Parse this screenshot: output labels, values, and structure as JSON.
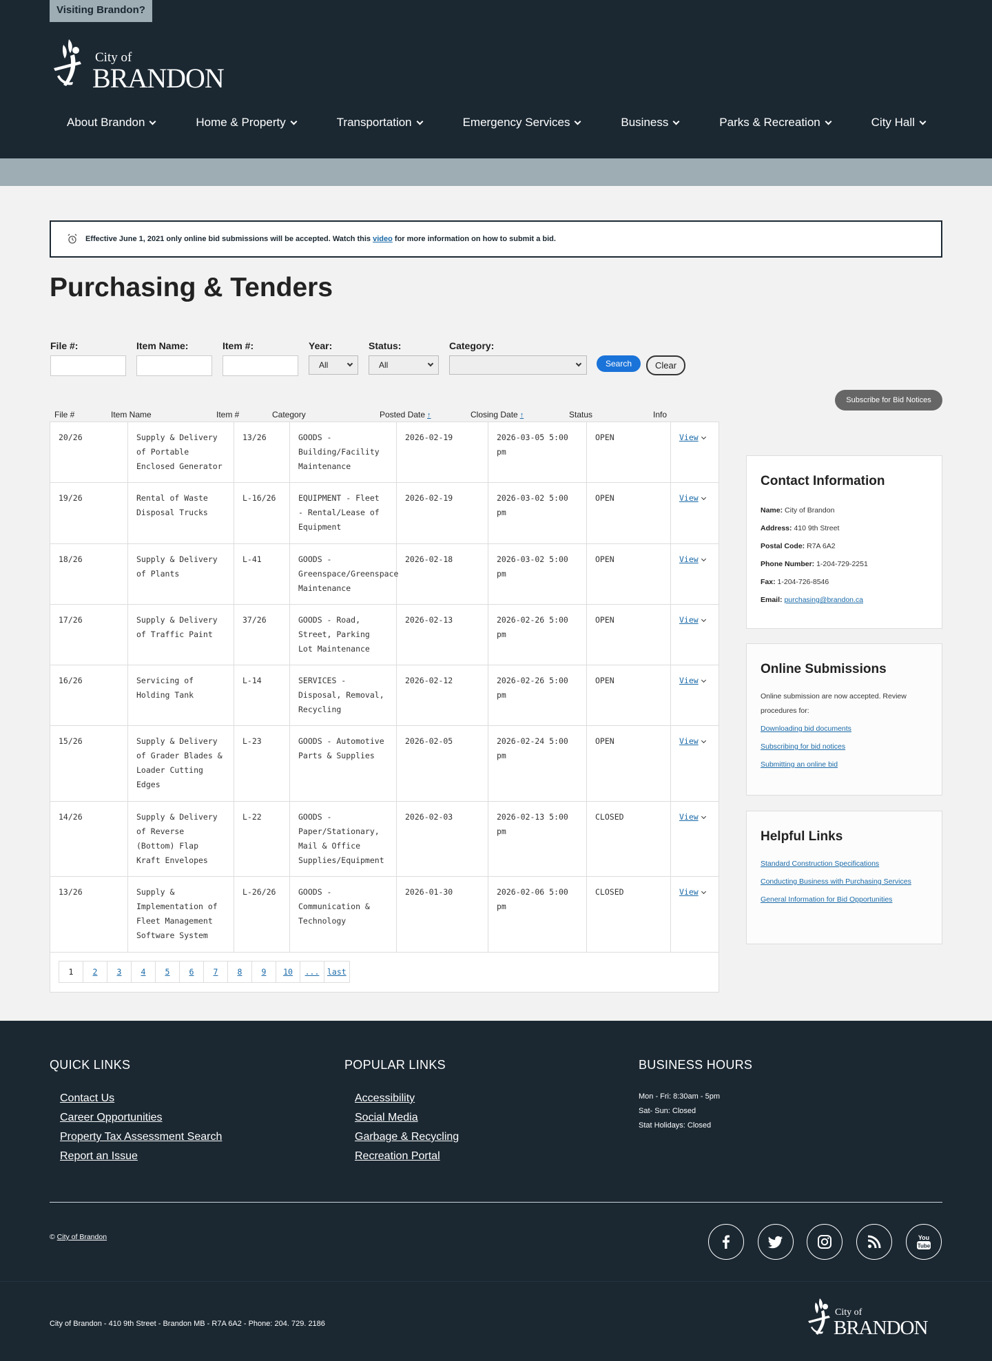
{
  "header": {
    "visiting": "Visiting Brandon?",
    "logo_small": "City of",
    "logo_big": "BRANDON",
    "nav": [
      "About Brandon",
      "Home & Property",
      "Transportation",
      "Emergency Services",
      "Business",
      "Parks & Recreation",
      "City Hall"
    ]
  },
  "notice": {
    "before": "Effective June 1, 2021 only online bid submissions will be accepted. Watch this",
    "link": "video",
    "after": "for more information on how to submit a bid."
  },
  "page_title": "Purchasing & Tenders",
  "filters": {
    "file_label": "File #:",
    "item_name_label": "Item Name:",
    "item_no_label": "Item #:",
    "year_label": "Year:",
    "year_value": "All",
    "status_label": "Status:",
    "status_value": "All",
    "category_label": "Category:",
    "category_value": "",
    "search": "Search",
    "clear": "Clear",
    "subscribe": "Subscribe for Bid Notices"
  },
  "table": {
    "headers": {
      "file": "File #",
      "item_name": "Item Name",
      "item_no": "Item #",
      "category": "Category",
      "posted": "Posted Date",
      "closing": "Closing Date",
      "status": "Status",
      "info": "Info",
      "sort_glyph": "↑"
    },
    "rows": [
      {
        "file": "20/26",
        "name": "Supply & Delivery of Portable Enclosed Generator",
        "item": "13/26",
        "category": "GOODS - Building/Facility Maintenance",
        "posted": "2026-02-19",
        "closing": "2026-03-05 5:00 pm",
        "status": "OPEN",
        "info": "View"
      },
      {
        "file": "19/26",
        "name": "Rental of Waste Disposal Trucks",
        "item": "L-16/26",
        "category": "EQUIPMENT - Fleet - Rental/Lease of Equipment",
        "posted": "2026-02-19",
        "closing": "2026-03-02 5:00 pm",
        "status": "OPEN",
        "info": "View"
      },
      {
        "file": "18/26",
        "name": "Supply & Delivery of Plants",
        "item": "L-41",
        "category": "GOODS - Greenspace/Greenspace Maintenance",
        "posted": "2026-02-18",
        "closing": "2026-03-02 5:00 pm",
        "status": "OPEN",
        "info": "View"
      },
      {
        "file": "17/26",
        "name": "Supply & Delivery of Traffic Paint",
        "item": "37/26",
        "category": "GOODS - Road, Street, Parking Lot Maintenance",
        "posted": "2026-02-13",
        "closing": "2026-02-26 5:00 pm",
        "status": "OPEN",
        "info": "View"
      },
      {
        "file": "16/26",
        "name": "Servicing of Holding Tank",
        "item": "L-14",
        "category": "SERVICES - Disposal, Removal, Recycling",
        "posted": "2026-02-12",
        "closing": "2026-02-26 5:00 pm",
        "status": "OPEN",
        "info": "View"
      },
      {
        "file": "15/26",
        "name": "Supply & Delivery of Grader Blades & Loader Cutting Edges",
        "item": "L-23",
        "category": "GOODS - Automotive Parts & Supplies",
        "posted": "2026-02-05",
        "closing": "2026-02-24 5:00 pm",
        "status": "OPEN",
        "info": "View"
      },
      {
        "file": "14/26",
        "name": "Supply & Delivery of Reverse (Bottom) Flap Kraft Envelopes",
        "item": "L-22",
        "category": "GOODS - Paper/Stationary, Mail & Office Supplies/Equipment",
        "posted": "2026-02-03",
        "closing": "2026-02-13 5:00 pm",
        "status": "CLOSED",
        "info": "View"
      },
      {
        "file": "13/26",
        "name": "Supply & Implementation of Fleet Management Software System",
        "item": "L-26/26",
        "category": "GOODS - Communication & Technology",
        "posted": "2026-01-30",
        "closing": "2026-02-06 5:00 pm",
        "status": "CLOSED",
        "info": "View"
      }
    ],
    "pages": [
      "1",
      "2",
      "3",
      "4",
      "5",
      "6",
      "7",
      "8",
      "9",
      "10",
      "...",
      "last"
    ]
  },
  "contact": {
    "title": "Contact Information",
    "lines": [
      {
        "label": "Name:",
        "value": "City of Brandon"
      },
      {
        "label": "Address:",
        "value": "410 9th Street"
      },
      {
        "label": "Postal Code:",
        "value": "R7A 6A2"
      },
      {
        "label": "Phone Number:",
        "value": "1-204-729-2251"
      },
      {
        "label": "Fax:",
        "value": "1-204-726-8546"
      }
    ],
    "email_label": "Email:",
    "email": "purchasing@brandon.ca"
  },
  "online": {
    "title": "Online Submissions",
    "text": "Online submission are now accepted. Review procedures for:",
    "links": [
      "Downloading bid documents",
      "Subscribing for bid notices",
      "Submitting an online bid"
    ]
  },
  "helpful": {
    "title": "Helpful Links",
    "links": [
      "Standard Construction Specifications",
      "Conducting Business with Purchasing Services",
      "General Information for Bid Opportunities"
    ]
  },
  "footer": {
    "quick_title": "QUICK LINKS",
    "quick": [
      "Contact Us",
      "Career Opportunities",
      "Property Tax Assessment Search",
      "Report an Issue"
    ],
    "popular_title": "POPULAR LINKS",
    "popular": [
      "Accessibility",
      "Social Media",
      "Garbage & Recycling",
      "Recreation Portal"
    ],
    "hours_title": "BUSINESS HOURS",
    "hours": [
      "Mon - Fri: 8:30am - 5pm",
      "Sat- Sun: Closed",
      "Stat Holidays: Closed"
    ],
    "copyright_symbol": "©",
    "copyright_link": "City of Brandon",
    "social": [
      "facebook-icon",
      "twitter-icon",
      "instagram-icon",
      "rss-icon",
      "youtube-icon"
    ],
    "address": "City of Brandon - 410 9th Street - Brandon MB - R7A 6A2 - Phone: 204. 729. 2186"
  },
  "colors": {
    "header_bg": "#1b2832",
    "band": "#9eadb4",
    "accent_blue": "#1a73d9",
    "link": "#1a6aa8"
  }
}
